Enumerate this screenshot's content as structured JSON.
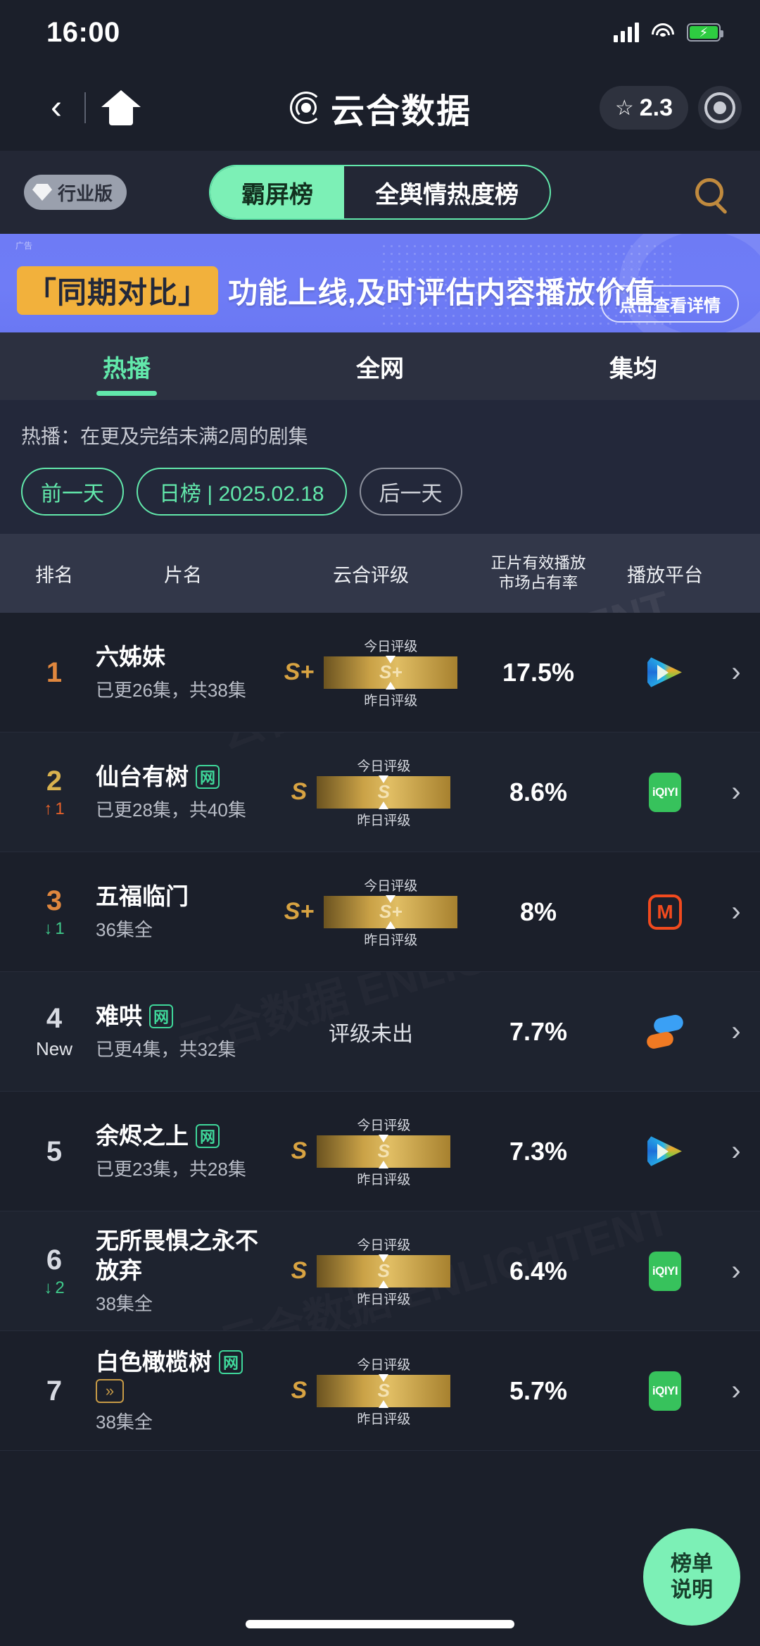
{
  "status_bar": {
    "time": "16:00",
    "signal_icon": "signal-bars-icon",
    "wifi_icon": "wifi-icon",
    "battery_icon": "battery-charging-icon"
  },
  "nav": {
    "back_icon": "chevron-left-icon",
    "home_icon": "home-icon",
    "logo_icon": "yunhe-swirl-logo-icon",
    "title": "云合数据",
    "star_icon": "star-icon",
    "score": "2.3",
    "menu_icon": "target-dot-icon"
  },
  "toolbar": {
    "industry_badge": "行业版",
    "gem_icon": "gem-icon",
    "segments": [
      {
        "label": "霸屏榜",
        "active": true
      },
      {
        "label": "全舆情热度榜",
        "active": false
      }
    ],
    "search_icon": "search-icon"
  },
  "banner": {
    "tag": "「同期对比」",
    "text": "功能上线,及时评估内容播放价值",
    "cta": "点击查看详情",
    "corner_mark": "广告"
  },
  "tabs": [
    {
      "label": "热播",
      "active": true
    },
    {
      "label": "全网",
      "active": false
    },
    {
      "label": "集均",
      "active": false
    }
  ],
  "filters": {
    "note": "热播：在更及完结未满2周的剧集",
    "prev_day": "前一天",
    "period": "日榜 | 2025.02.18",
    "next_day": "后一天"
  },
  "table": {
    "headers": {
      "rank": "排名",
      "name": "片名",
      "rating": "云合评级",
      "share_line1": "正片有效播放",
      "share_line2": "市场占有率",
      "platform": "播放平台"
    },
    "rating_today_label": "今日评级",
    "rating_yesterday_label": "昨日评级",
    "no_rating_text": "评级未出",
    "arrow_icon": "chevron-right-icon",
    "rows": [
      {
        "rank": "1",
        "rank_color": "top",
        "delta": "",
        "delta_dir": "",
        "new_label": "",
        "title": "六姊妹",
        "web_badge": "",
        "ff_badge": "",
        "sub": "已更26集，共38集",
        "grade": "S+",
        "bar_grade": "S+",
        "has_rating": true,
        "share": "17.5%",
        "platform_icon": "tencent-video-icon"
      },
      {
        "rank": "2",
        "rank_color": "gold",
        "delta": "1",
        "delta_dir": "up",
        "new_label": "",
        "title": "仙台有树",
        "web_badge": "网",
        "ff_badge": "",
        "sub": "已更28集，共40集",
        "grade": "S",
        "bar_grade": "S",
        "has_rating": true,
        "share": "8.6%",
        "platform_icon": "iqiyi-icon"
      },
      {
        "rank": "3",
        "rank_color": "top",
        "delta": "1",
        "delta_dir": "down",
        "new_label": "",
        "title": "五福临门",
        "web_badge": "",
        "ff_badge": "",
        "sub": "36集全",
        "grade": "S+",
        "bar_grade": "S+",
        "has_rating": true,
        "share": "8%",
        "platform_icon": "mango-tv-icon"
      },
      {
        "rank": "4",
        "rank_color": "",
        "delta": "",
        "delta_dir": "",
        "new_label": "New",
        "title": "难哄",
        "web_badge": "网",
        "ff_badge": "",
        "sub": "已更4集，共32集",
        "grade": "",
        "bar_grade": "",
        "has_rating": false,
        "share": "7.7%",
        "platform_icon": "youku-icon"
      },
      {
        "rank": "5",
        "rank_color": "",
        "delta": "",
        "delta_dir": "",
        "new_label": "",
        "title": "余烬之上",
        "web_badge": "网",
        "ff_badge": "",
        "sub": "已更23集，共28集",
        "grade": "S",
        "bar_grade": "S",
        "has_rating": true,
        "share": "7.3%",
        "platform_icon": "tencent-video-icon"
      },
      {
        "rank": "6",
        "rank_color": "",
        "delta": "2",
        "delta_dir": "down",
        "new_label": "",
        "title": "无所畏惧之永不放弃",
        "web_badge": "",
        "ff_badge": "",
        "sub": "38集全",
        "grade": "S",
        "bar_grade": "S",
        "has_rating": true,
        "share": "6.4%",
        "platform_icon": "iqiyi-icon"
      },
      {
        "rank": "7",
        "rank_color": "",
        "delta": "",
        "delta_dir": "",
        "new_label": "",
        "title": "白色橄榄树",
        "web_badge": "网",
        "ff_badge": "»",
        "sub": "38集全",
        "grade": "S",
        "bar_grade": "S",
        "has_rating": true,
        "share": "5.7%",
        "platform_icon": "iqiyi-icon"
      }
    ]
  },
  "fab": {
    "line1": "榜单",
    "line2": "说明"
  },
  "watermark": "云合数据 ENLIGHTENT",
  "colors": {
    "accent_green": "#62e8ab",
    "banner_purple": "#6e7bf5",
    "badge_orange": "#f2b13c",
    "rank_up": "#e8622a",
    "rank_down": "#3fc98a",
    "gold": "#d8a342"
  }
}
